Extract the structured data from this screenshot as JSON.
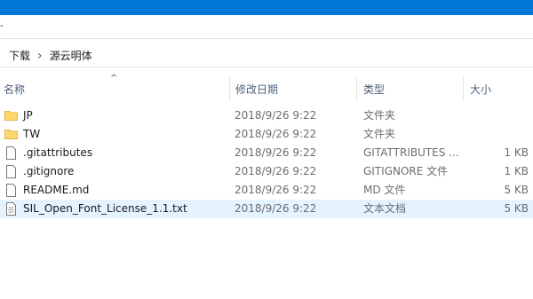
{
  "breadcrumb": {
    "items": [
      "下载",
      "源云明体"
    ],
    "separator": "›"
  },
  "columns": {
    "name": "名称",
    "date": "修改日期",
    "type": "类型",
    "size": "大小"
  },
  "files": [
    {
      "name": "JP",
      "date": "2018/9/26 9:22",
      "type": "文件夹",
      "size": "",
      "icon": "folder-icon"
    },
    {
      "name": "TW",
      "date": "2018/9/26 9:22",
      "type": "文件夹",
      "size": "",
      "icon": "folder-icon"
    },
    {
      "name": ".gitattributes",
      "date": "2018/9/26 9:22",
      "type": "GITATTRIBUTES ...",
      "size": "1 KB",
      "icon": "file-icon"
    },
    {
      "name": ".gitignore",
      "date": "2018/9/26 9:22",
      "type": "GITIGNORE 文件",
      "size": "1 KB",
      "icon": "file-icon"
    },
    {
      "name": "README.md",
      "date": "2018/9/26 9:22",
      "type": "MD 文件",
      "size": "5 KB",
      "icon": "file-icon"
    },
    {
      "name": "SIL_Open_Font_License_1.1.txt",
      "date": "2018/9/26 9:22",
      "type": "文本文档",
      "size": "5 KB",
      "icon": "text-file-icon",
      "selected": true
    }
  ],
  "colors": {
    "titlebar": "#0078d7",
    "selection": "#e5f3ff",
    "header_text": "#4c607a",
    "folder": "#ffd86b"
  }
}
